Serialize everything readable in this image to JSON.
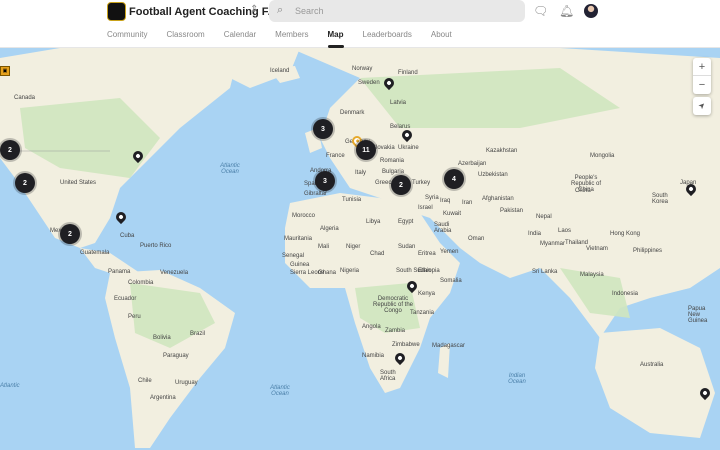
{
  "header": {
    "community_name": "Football Agent Coaching FACE",
    "search_placeholder": "Search"
  },
  "tabs": [
    {
      "label": "Community"
    },
    {
      "label": "Classroom"
    },
    {
      "label": "Calendar"
    },
    {
      "label": "Members"
    },
    {
      "label": "Map",
      "active": true
    },
    {
      "label": "Leaderboards"
    },
    {
      "label": "About"
    }
  ],
  "map": {
    "labels": [
      "Canada",
      "United States",
      "Mexico",
      "Cuba",
      "Puerto Rico",
      "Guatemala",
      "Panama",
      "Colombia",
      "Venezuela",
      "Ecuador",
      "Peru",
      "Brazil",
      "Bolivia",
      "Paraguay",
      "Chile",
      "Uruguay",
      "Argentina",
      "Iceland",
      "Norway",
      "Sweden",
      "Finland",
      "Denmark",
      "Latvia",
      "Belarus",
      "Ukraine",
      "Germany",
      "France",
      "Slovakia",
      "Romania",
      "Bulgaria",
      "Italy",
      "Spain",
      "Andorra",
      "Greece",
      "Turkey",
      "Gibraltar",
      "Tunisia",
      "Morocco",
      "Algeria",
      "Libya",
      "Egypt",
      "Mauritania",
      "Mali",
      "Niger",
      "Chad",
      "Sudan",
      "Senegal",
      "Guinea",
      "Sierra Leone",
      "Ghana",
      "Nigeria",
      "South Sudan",
      "Ethiopia",
      "Somalia",
      "Kenya",
      "Democratic Republic of the Congo",
      "Tanzania",
      "Angola",
      "Zambia",
      "Zimbabwe",
      "Namibia",
      "Madagascar",
      "South Africa",
      "Syria",
      "Israel",
      "Iraq",
      "Iran",
      "Kuwait",
      "Saudi Arabia",
      "Oman",
      "Yemen",
      "Eritrea",
      "Kazakhstan",
      "Uzbekistan",
      "Afghanistan",
      "Pakistan",
      "India",
      "Nepal",
      "Sri Lanka",
      "Mongolia",
      "China",
      "People's Republic of China",
      "South Korea",
      "Japan",
      "Myanmar",
      "Thailand",
      "Laos",
      "Vietnam",
      "Hong Kong",
      "Philippines",
      "Malaysia",
      "Indonesia",
      "Papua New Guinea",
      "Australia",
      "Azerbaijan"
    ],
    "oceans": [
      "Atlantic Ocean",
      "Atlantic Ocean",
      "Indian Ocean",
      "Atlantic"
    ],
    "clusters": [
      {
        "count": "2"
      },
      {
        "count": "2"
      },
      {
        "count": "2"
      },
      {
        "count": "3"
      },
      {
        "count": "3"
      },
      {
        "count": "11"
      },
      {
        "count": "2"
      },
      {
        "count": "4"
      }
    ],
    "controls": {
      "zoom_in": "+",
      "zoom_out": "−",
      "locate": "➤"
    }
  },
  "colors": {
    "water": "#a9d3f3",
    "land": "#f5f1e3",
    "forest": "#cfe6bf",
    "marker": "#1f1f23",
    "highlight": "#e6a92c"
  }
}
